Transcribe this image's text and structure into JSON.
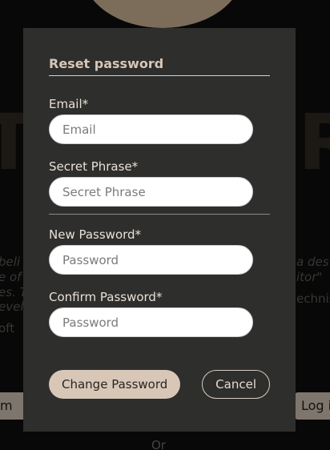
{
  "background": {
    "letter_left": "T",
    "letter_right": "R",
    "line1_left": "beli",
    "line1_right": "a des",
    "line2_left": "e of c",
    "line2_right": "itor\"",
    "line3_left": "es. T",
    "line3_right": "echnis",
    "line4_left": "evels",
    "line5_left": "oft",
    "button_left": "m",
    "button_right": "Log i",
    "or_label": "Or"
  },
  "modal": {
    "title": "Reset password",
    "email": {
      "label": "Email*",
      "placeholder": "Email",
      "value": ""
    },
    "secret_phrase": {
      "label": "Secret Phrase*",
      "placeholder": "Secret Phrase",
      "value": ""
    },
    "new_password": {
      "label": "New Password*",
      "placeholder": "Password",
      "value": ""
    },
    "confirm_password": {
      "label": "Confirm Password*",
      "placeholder": "Password",
      "value": ""
    },
    "change_button_label": "Change Password",
    "cancel_button_label": "Cancel"
  },
  "colors": {
    "modal_background": "#2e2e2d",
    "primary_button": "#d8c7b7",
    "page_background": "#0d0d0d"
  }
}
